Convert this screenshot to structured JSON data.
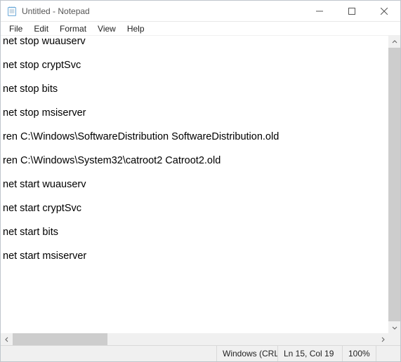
{
  "titlebar": {
    "title": "Untitled - Notepad"
  },
  "menubar": {
    "items": [
      "File",
      "Edit",
      "Format",
      "View",
      "Help"
    ]
  },
  "editor": {
    "text": "net stop wuauserv\n\nnet stop cryptSvc\n\nnet stop bits\n\nnet stop msiserver\n\nren C:\\Windows\\SoftwareDistribution SoftwareDistribution.old\n\nren C:\\Windows\\System32\\catroot2 Catroot2.old\n\nnet start wuauserv\n\nnet start cryptSvc\n\nnet start bits\n\nnet start msiserver"
  },
  "statusbar": {
    "line_ending": "Windows (CRLF",
    "position": "Ln 15, Col 19",
    "zoom": "100%"
  }
}
